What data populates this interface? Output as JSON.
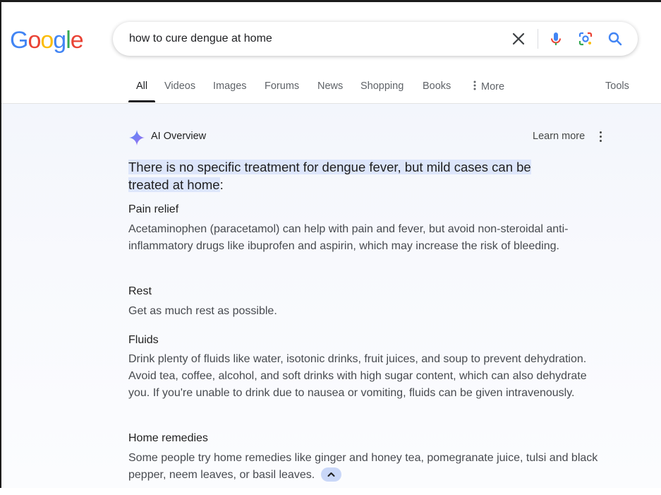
{
  "logo": {
    "letters": [
      "G",
      "o",
      "o",
      "g",
      "l",
      "e"
    ],
    "colors": [
      "#4285F4",
      "#EA4335",
      "#FBBC05",
      "#4285F4",
      "#34A853",
      "#EA4335"
    ]
  },
  "search": {
    "query": "how to cure dengue at home"
  },
  "icons": {
    "clear": "close-icon",
    "voice": "microphone-icon",
    "lens": "camera-lens-icon",
    "submit": "search-icon"
  },
  "tabs": [
    {
      "label": "All",
      "active": true
    },
    {
      "label": "Videos"
    },
    {
      "label": "Images"
    },
    {
      "label": "Forums"
    },
    {
      "label": "News"
    },
    {
      "label": "Shopping"
    },
    {
      "label": "Books"
    },
    {
      "label": "More"
    }
  ],
  "tools_label": "Tools",
  "ai_overview": {
    "title": "AI Overview",
    "learn_more": "Learn more",
    "lead_highlight_1": "There is no specific treatment for dengue fever, but mild cases can be",
    "lead_highlight_2": "treated at home",
    "lead_tail": ":",
    "sections": [
      {
        "heading": "Pain relief",
        "body": "Acetaminophen (paracetamol) can help with pain and fever, but avoid non-steroidal anti-inflammatory drugs like ibuprofen and aspirin, which may increase the risk of bleeding."
      },
      {
        "heading": "Rest",
        "body": "Get as much rest as possible."
      },
      {
        "heading": "Fluids",
        "body": "Drink plenty of fluids like water, isotonic drinks, fruit juices, and soup to prevent dehydration. Avoid tea, coffee, alcohol, and soft drinks with high sugar content, which can also dehydrate you. If you're unable to drink due to nausea or vomiting, fluids can be given intravenously."
      },
      {
        "heading": "Home remedies",
        "body": "Some people try home remedies like ginger and honey tea, pomegranate juice, tulsi and black pepper, neem leaves, or basil leaves."
      }
    ]
  }
}
